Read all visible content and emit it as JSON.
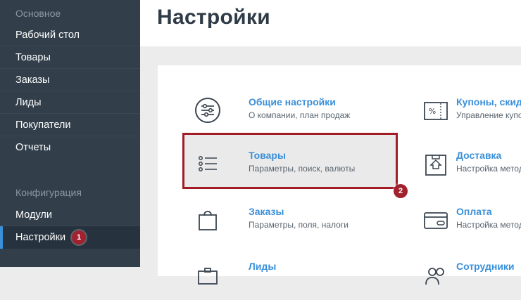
{
  "sidebar": {
    "section_main": "Основное",
    "items": [
      "Рабочий стол",
      "Товары",
      "Заказы",
      "Лиды",
      "Покупатели",
      "Отчеты"
    ],
    "section_config": "Конфигурация",
    "config_items": [
      "Модули",
      "Настройки"
    ],
    "active_item": "Настройки",
    "step_badge": "1"
  },
  "header": {
    "title": "Настройки"
  },
  "settings_cards": [
    {
      "title": "Общие настройки",
      "subtitle": "О компании, план продаж",
      "icon": "sliders-icon"
    },
    {
      "title": "Товары",
      "subtitle": "Параметры, поиск, валюты",
      "icon": "list-icon",
      "highlighted": true
    },
    {
      "title": "Заказы",
      "subtitle": "Параметры, поля, налоги",
      "icon": "shopping-bag-icon"
    },
    {
      "title": "Лиды",
      "subtitle": "",
      "icon": "briefcase-icon"
    },
    {
      "title": "Купоны, скид",
      "subtitle": "Управление купо",
      "icon": "coupon-icon"
    },
    {
      "title": "Доставка",
      "subtitle": "Настройка метод",
      "icon": "box-icon"
    },
    {
      "title": "Оплата",
      "subtitle": "Настройка метод",
      "icon": "credit-card-icon"
    },
    {
      "title": "Сотрудники",
      "subtitle": "",
      "icon": "users-icon"
    }
  ],
  "step_badge_2": "2",
  "colors": {
    "sidebar_bg": "#323f4b",
    "accent": "#3a8fd9",
    "highlight": "#a31b27"
  }
}
